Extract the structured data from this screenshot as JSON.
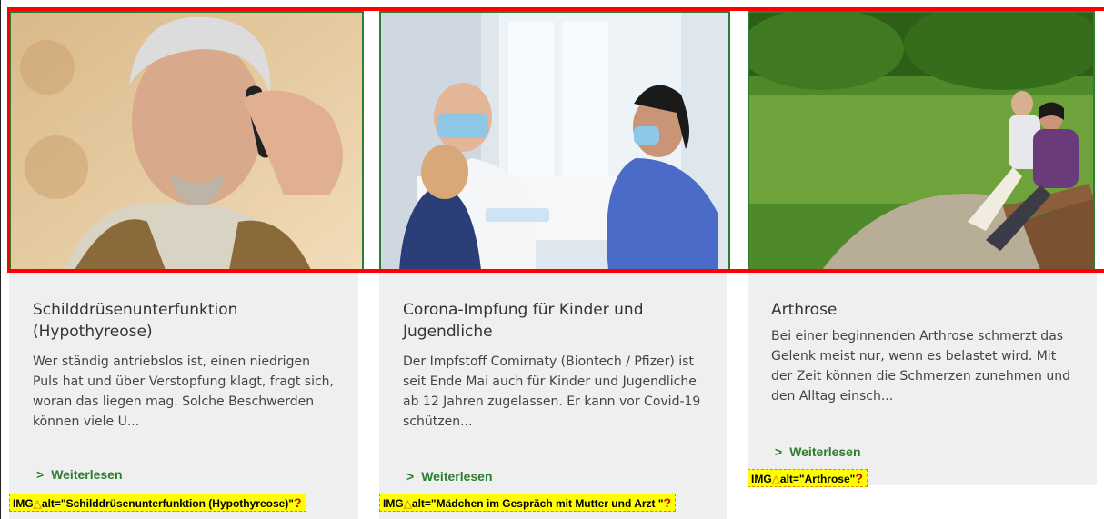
{
  "cards": [
    {
      "title": "Schilddrüsenunterfunktion (Hypothyreose)",
      "description": "Wer ständig antriebslos ist, einen niedrigen Puls hat und über Verstopfung klagt, fragt sich, woran das liegen mag. Solche Beschwerden können viele U...",
      "more_label": "Weiterlesen",
      "alt_label": "alt=\"Schilddrüsenunterfunktion (Hypothyreose)\""
    },
    {
      "title": "Corona-Impfung für Kinder und Jugendliche",
      "description": "Der Impfstoff Comirnaty (Biontech / Pfizer) ist seit Ende Mai auch für Kinder und Jugendliche ab 12 Jahren zugelassen. Er kann vor Covid-19 schützen...",
      "more_label": "Weiterlesen",
      "alt_label": "alt=\"Mädchen im Gespräch mit Mutter und Arzt \""
    },
    {
      "title": "Arthrose",
      "description": "Bei einer beginnenden Arthrose schmerzt das Gelenk meist nur, wenn es belastet wird. Mit der Zeit können die Schmerzen zunehmen und den Alltag einsch...",
      "more_label": "Weiterlesen",
      "alt_label": "alt=\"Arthrose\""
    }
  ],
  "img_tag_prefix": "IMG",
  "chevron": ">",
  "colors": {
    "accent_green": "#2e7d32",
    "highlight_red": "#ff0000",
    "alt_tag_bg": "#ffff00",
    "card_bg": "#efefef"
  },
  "icons": [
    "chevron-right-icon",
    "thumbs-up-icon",
    "question-mark-icon"
  ]
}
